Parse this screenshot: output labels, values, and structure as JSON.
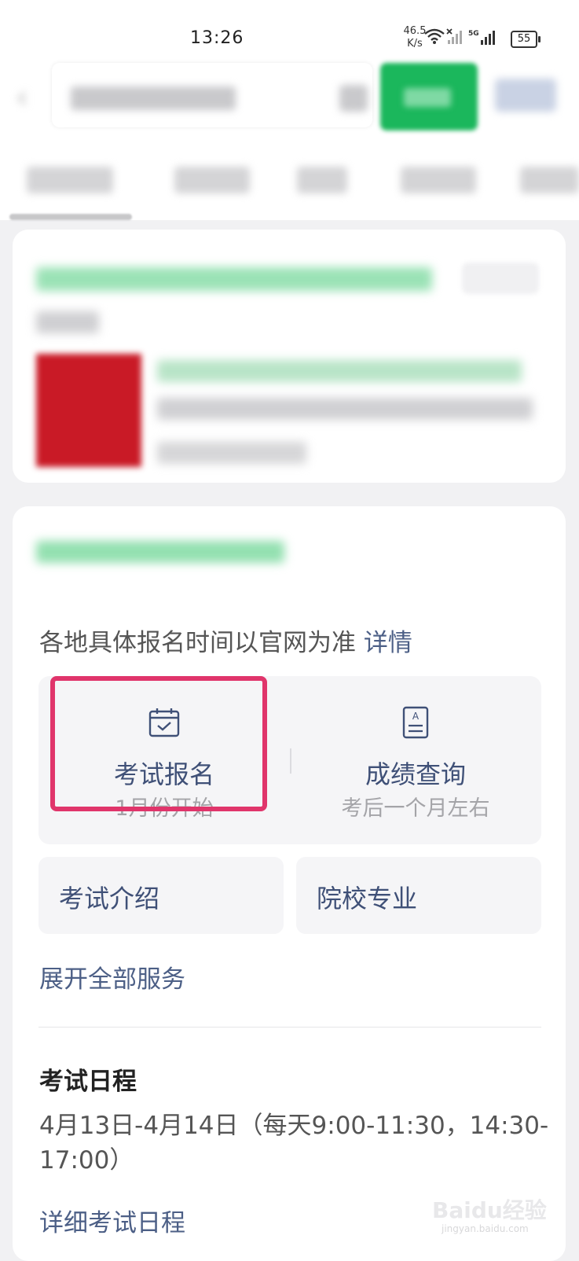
{
  "status_bar": {
    "time": "13:26",
    "net_speed_value": "46.5",
    "net_speed_unit": "K/s",
    "signal_label": "5G",
    "battery": "55"
  },
  "colors": {
    "accent_green": "#1bb75c",
    "link_blue": "#4c5f86",
    "highlight_pink": "#e0356b"
  },
  "exam_card": {
    "notice_text": "各地具体报名时间以官网为准",
    "notice_link": "详情",
    "services": [
      {
        "title": "考试报名",
        "subtitle": "1月份开始",
        "icon": "calendar-check-icon"
      },
      {
        "title": "成绩查询",
        "subtitle": "考后一个月左右",
        "icon": "document-icon"
      }
    ],
    "quick_links": [
      "考试介绍",
      "院校专业"
    ],
    "expand_label": "展开全部服务",
    "schedule": {
      "title": "考试日程",
      "detail": "4月13日-4月14日（每天9:00-11:30，14:30-17:00）",
      "link": "详细考试日程"
    }
  },
  "watermark": {
    "text": "Baidu经验",
    "url": "jingyan.baidu.com"
  }
}
